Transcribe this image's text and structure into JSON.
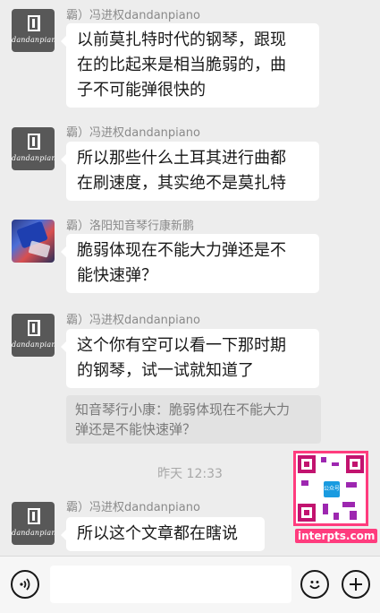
{
  "messages": [
    {
      "sender": "霸）冯进权dandanpiano",
      "avatar_text": "dandanpiano",
      "lines": [
        "以前莫扎特时代的钢琴，跟现",
        "在的比起来是相当脆弱的，曲",
        "子不可能弹很快的"
      ]
    },
    {
      "sender": "霸）冯进权dandanpiano",
      "avatar_text": "dandanpiano",
      "lines": [
        "所以那些什么土耳其进行曲都",
        "在刷速度，其实绝不是莫扎特"
      ]
    },
    {
      "sender": "霸）洛阳知音琴行康新鹏",
      "lines": [
        "脆弱体现在不能大力弹还是不",
        "能快速弹？"
      ]
    },
    {
      "sender": "霸）冯进权dandanpiano",
      "avatar_text": "dandanpiano",
      "lines": [
        "这个你有空可以看一下那时期",
        "的钢琴，试一试就知道了"
      ]
    },
    {
      "sender": "霸）冯进权dandanpiano",
      "avatar_text": "dandanpiano",
      "lines": [
        "所以这个文章都在瞎说"
      ]
    }
  ],
  "quote": {
    "lines": [
      "知音琴行小康：脆弱体现在不能大力",
      "弹还是不能快速弹？"
    ]
  },
  "timestamp": "昨天 12:33",
  "watermark": "interpts.com",
  "qr_center_text": "公众号",
  "input_bar": {
    "voice_icon": "voice-icon",
    "emoji_icon": "emoji-icon",
    "plus_icon": "plus-icon",
    "input_value": ""
  },
  "colors": {
    "background": "#ededed",
    "bubble": "#ffffff",
    "quote_bg": "#e2e2e2",
    "sender_text": "#8a8a8a"
  }
}
